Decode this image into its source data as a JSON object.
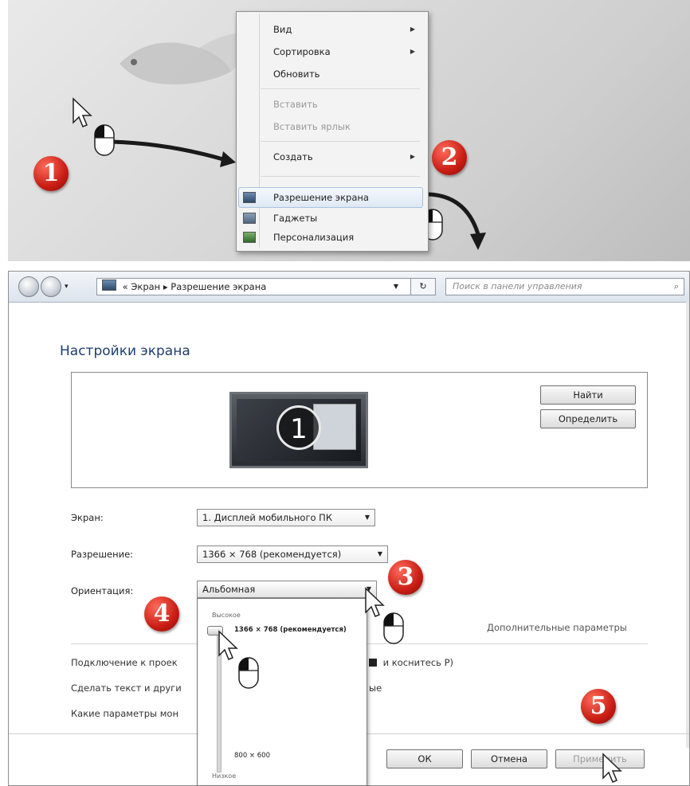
{
  "context_menu": {
    "items": [
      {
        "label": "Вид",
        "submenu": true,
        "disabled": false
      },
      {
        "label": "Сортировка",
        "submenu": true,
        "disabled": false
      },
      {
        "label": "Обновить",
        "submenu": false,
        "disabled": false
      },
      {
        "label": "Вставить",
        "submenu": false,
        "disabled": true
      },
      {
        "label": "Вставить ярлык",
        "submenu": false,
        "disabled": true
      },
      {
        "label": "Создать",
        "submenu": true,
        "disabled": false
      },
      {
        "label": "Разрешение экрана",
        "submenu": false,
        "disabled": false,
        "highlighted": true
      },
      {
        "label": "Гаджеты",
        "submenu": false,
        "disabled": false
      },
      {
        "label": "Персонализация",
        "submenu": false,
        "disabled": false
      }
    ]
  },
  "steps": [
    "1",
    "2",
    "3",
    "4",
    "5"
  ],
  "window": {
    "breadcrumb_prefix": "«",
    "breadcrumb": [
      "Экран",
      "Разрешение экрана"
    ],
    "breadcrumb_sep": "▸",
    "refresh_label": "↻",
    "search_placeholder": "Поиск в панели управления",
    "search_icon": "⌕",
    "page_title": "Настройки экрана",
    "monitor_number": "1",
    "identify_buttons": {
      "find": "Найти",
      "detect": "Определить"
    },
    "display": {
      "label": "Экран:",
      "value": "1. Дисплей мобильного ПК"
    },
    "resolution": {
      "label": "Разрешение:",
      "value": "1366 × 768 (рекомендуется)"
    },
    "orientation": {
      "label": "Ориентация:",
      "value": "Альбомная"
    },
    "resolution_dropdown": {
      "high_label": "Высокое",
      "low_label": "Низкое",
      "top_value": "1366 × 768 (рекомендуется)",
      "bottom_value": "800 × 600",
      "slider_level": 1.0
    },
    "advanced_link": "Дополнительные параметры",
    "links": [
      {
        "left": "Подключение к проек",
        "right": "и коснитесь P)"
      },
      {
        "left": "Сделать текст и други",
        "right": "ые"
      },
      {
        "left": "Какие параметры мон",
        "right": ""
      }
    ],
    "buttons": {
      "ok": "ОК",
      "cancel": "Отмена",
      "apply": "Применить"
    }
  },
  "colors": {
    "badge": "#c81d14",
    "title": "#1e3d6e"
  }
}
